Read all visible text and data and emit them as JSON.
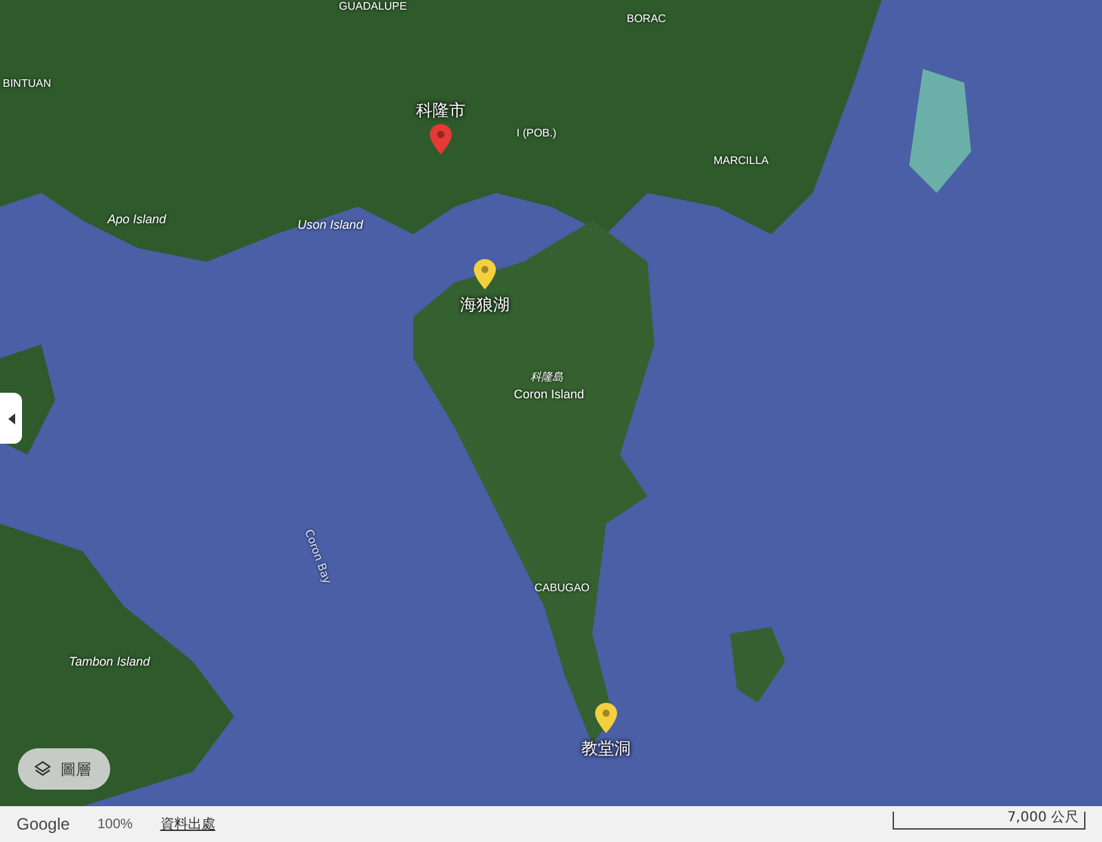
{
  "map": {
    "place_labels": [
      {
        "kind": "town",
        "text": "GUADALUPE"
      },
      {
        "kind": "town",
        "text": "BORAC"
      },
      {
        "kind": "town",
        "text": "BINTUAN"
      },
      {
        "kind": "town",
        "text": "I (POB.)"
      },
      {
        "kind": "town",
        "text": "MARCILLA"
      },
      {
        "kind": "island",
        "text": "Apo Island"
      },
      {
        "kind": "island",
        "text": "Uson Island"
      },
      {
        "kind": "island_local",
        "text": "科隆島"
      },
      {
        "kind": "plain",
        "text": "Coron Island"
      },
      {
        "kind": "water",
        "text": "Coron Bay"
      },
      {
        "kind": "town",
        "text": "CABUGAO"
      },
      {
        "kind": "island",
        "text": "Tambon Island"
      }
    ],
    "pins": [
      {
        "label": "科隆市",
        "color": "#e53935"
      },
      {
        "label": "海狼湖",
        "color": "#f4d03f"
      },
      {
        "label": "教堂洞",
        "color": "#f4d03f"
      }
    ],
    "layers_button": {
      "label": "圖層"
    }
  },
  "bottom_bar": {
    "logo": "Google",
    "zoom": "100%",
    "attribution_link": "資料出處",
    "scale": "7,000 公尺"
  }
}
